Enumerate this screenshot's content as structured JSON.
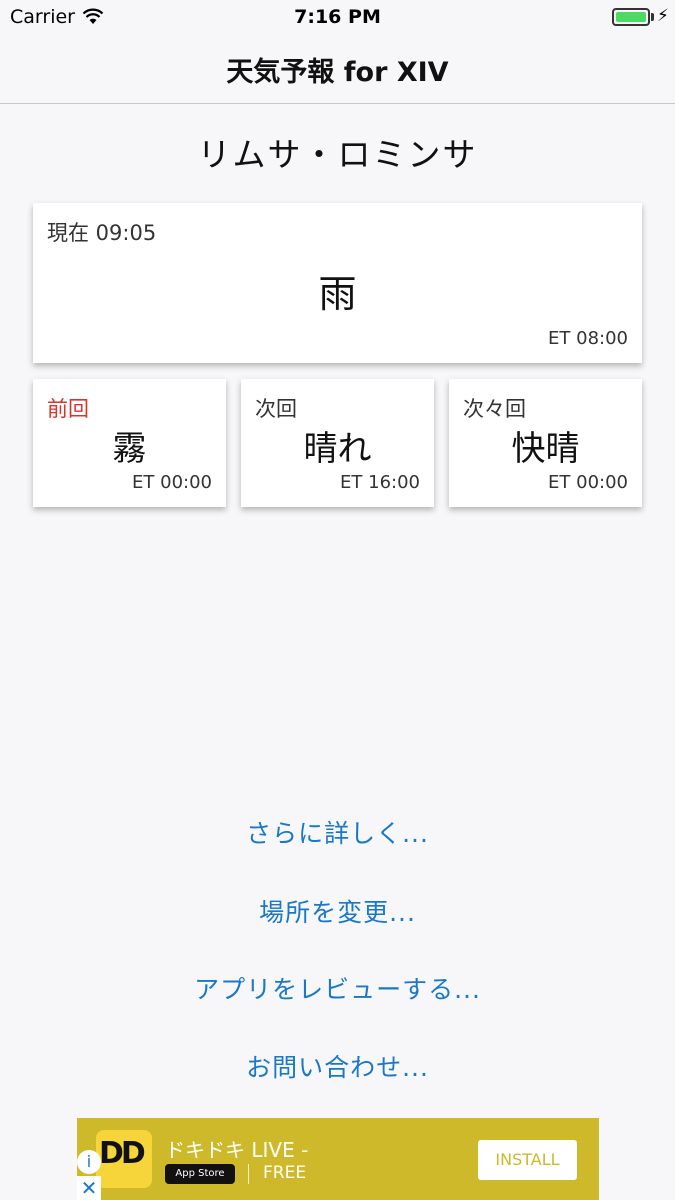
{
  "status_bar": {
    "carrier": "Carrier",
    "time": "7:16 PM",
    "charging_bolt": "⚡",
    "battery_color": "#4cd964"
  },
  "nav": {
    "title": "天気予報 for XIV"
  },
  "location": "リムサ・ロミンサ",
  "current": {
    "label": "現在 09:05",
    "weather": "雨",
    "et": "ET 08:00"
  },
  "forecasts": [
    {
      "label": "前回",
      "weather": "霧",
      "et": "ET 00:00",
      "label_color": "#d9342b"
    },
    {
      "label": "次回",
      "weather": "晴れ",
      "et": "ET 16:00"
    },
    {
      "label": "次々回",
      "weather": "快晴",
      "et": "ET 00:00"
    }
  ],
  "links": {
    "more_details": "さらに詳しく...",
    "change_location": "場所を変更...",
    "review_app": "アプリをレビューする...",
    "contact": "お問い合わせ..."
  },
  "ad": {
    "app_name": "ドキドキ LIVE -",
    "icon_text": "DD",
    "store_badge": "App Store",
    "price": "FREE",
    "install_label": "INSTALL",
    "info_icon": "i",
    "close_icon": "✕",
    "background_color": "#cdb92a"
  }
}
